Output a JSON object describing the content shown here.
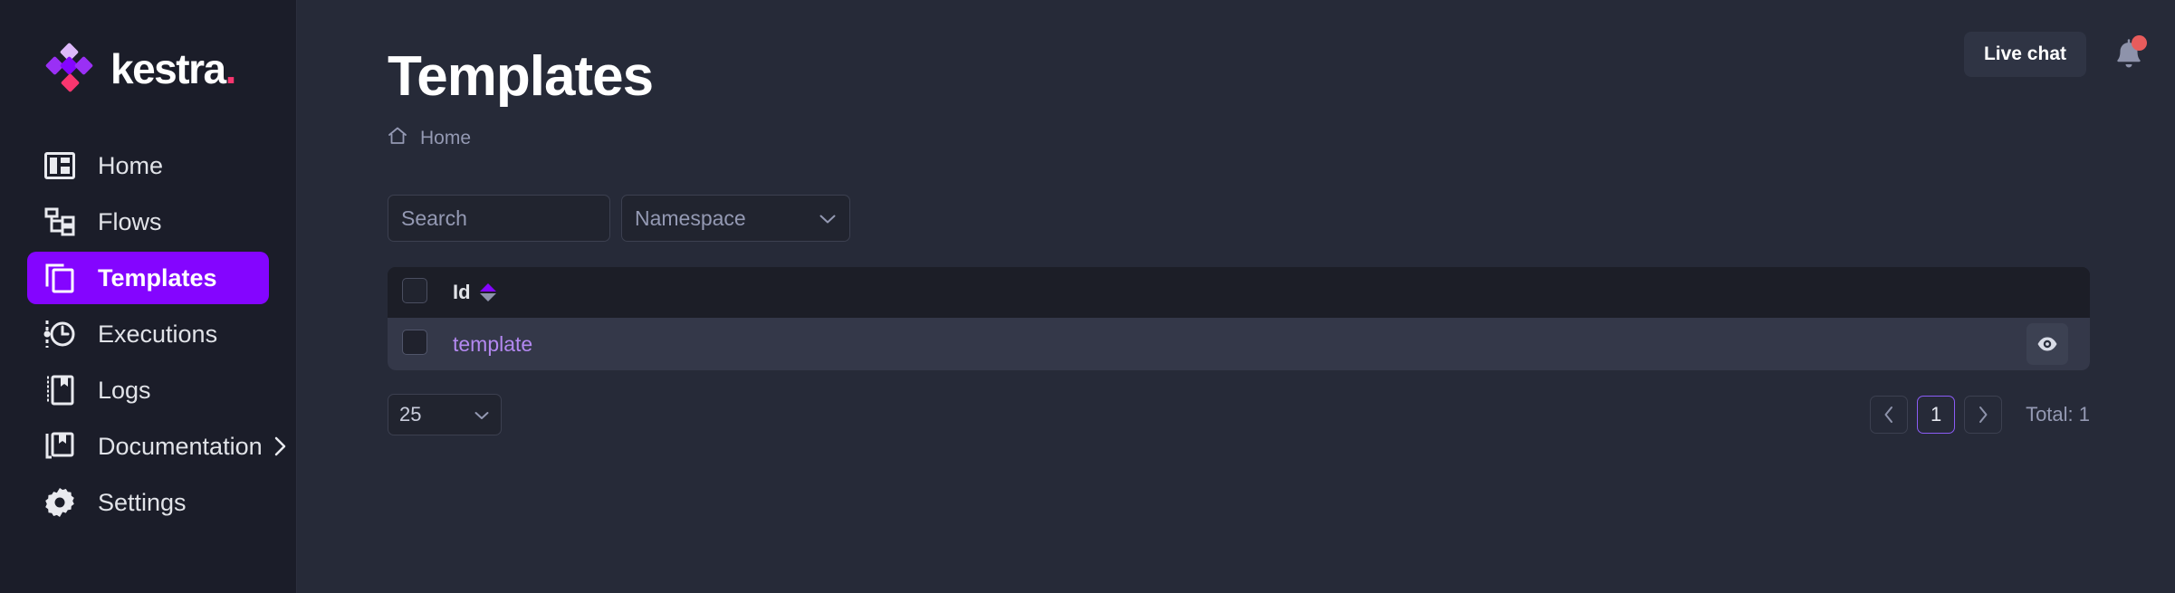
{
  "brand": {
    "name": "kestra",
    "dot": ".",
    "logo_icon": "kestra-diamond-logo",
    "purple": "#8405FF",
    "pink": "#F8366F"
  },
  "sidebar": {
    "items": [
      {
        "label": "Home",
        "icon": "dashboard-icon",
        "active": false,
        "has_chevron": false
      },
      {
        "label": "Flows",
        "icon": "flow-tree-icon",
        "active": false,
        "has_chevron": false
      },
      {
        "label": "Templates",
        "icon": "copy-pages-icon",
        "active": true,
        "has_chevron": false
      },
      {
        "label": "Executions",
        "icon": "clock-icon",
        "active": false,
        "has_chevron": false
      },
      {
        "label": "Logs",
        "icon": "notebook-icon",
        "active": false,
        "has_chevron": false
      },
      {
        "label": "Documentation",
        "icon": "book-icon",
        "active": false,
        "has_chevron": true
      },
      {
        "label": "Settings",
        "icon": "gear-icon",
        "active": false,
        "has_chevron": false
      }
    ]
  },
  "topbar": {
    "live_chat_label": "Live chat",
    "notification_icon": "bell-icon",
    "has_notification_badge": true,
    "badge_color": "#E85C5C"
  },
  "header": {
    "title": "Templates",
    "breadcrumb": {
      "home_icon": "home-icon",
      "items": [
        "Home"
      ]
    }
  },
  "filters": {
    "search": {
      "placeholder": "Search",
      "value": "",
      "icon": "search-icon"
    },
    "namespace": {
      "label": "Namespace",
      "icon": "chevron-down-icon"
    }
  },
  "table": {
    "columns": [
      {
        "key": "select",
        "label": "",
        "type": "checkbox"
      },
      {
        "key": "id",
        "label": "Id",
        "sortable": true,
        "sort_icon": "sort-asc-desc-icon",
        "sort_state": "asc"
      },
      {
        "key": "actions",
        "label": "",
        "type": "actions"
      }
    ],
    "rows": [
      {
        "selected": false,
        "id": "template",
        "action_icon": "eye-icon"
      }
    ]
  },
  "footer": {
    "page_size": "25",
    "page_size_icon": "chevron-down-icon",
    "pagination": {
      "prev_icon": "chevron-left-icon",
      "next_icon": "chevron-right-icon",
      "pages": [
        "1"
      ],
      "current_page": "1"
    },
    "total_label": "Total: 1"
  }
}
